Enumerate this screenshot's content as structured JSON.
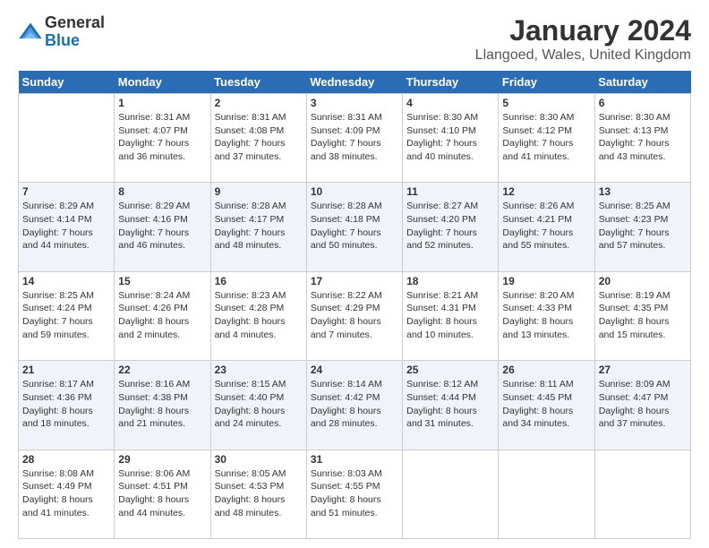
{
  "logo": {
    "general": "General",
    "blue": "Blue"
  },
  "title": "January 2024",
  "location": "Llangoed, Wales, United Kingdom",
  "weekdays": [
    "Sunday",
    "Monday",
    "Tuesday",
    "Wednesday",
    "Thursday",
    "Friday",
    "Saturday"
  ],
  "weeks": [
    [
      {
        "day": "",
        "sunrise": "",
        "sunset": "",
        "daylight": ""
      },
      {
        "day": "1",
        "sunrise": "Sunrise: 8:31 AM",
        "sunset": "Sunset: 4:07 PM",
        "daylight": "Daylight: 7 hours and 36 minutes."
      },
      {
        "day": "2",
        "sunrise": "Sunrise: 8:31 AM",
        "sunset": "Sunset: 4:08 PM",
        "daylight": "Daylight: 7 hours and 37 minutes."
      },
      {
        "day": "3",
        "sunrise": "Sunrise: 8:31 AM",
        "sunset": "Sunset: 4:09 PM",
        "daylight": "Daylight: 7 hours and 38 minutes."
      },
      {
        "day": "4",
        "sunrise": "Sunrise: 8:30 AM",
        "sunset": "Sunset: 4:10 PM",
        "daylight": "Daylight: 7 hours and 40 minutes."
      },
      {
        "day": "5",
        "sunrise": "Sunrise: 8:30 AM",
        "sunset": "Sunset: 4:12 PM",
        "daylight": "Daylight: 7 hours and 41 minutes."
      },
      {
        "day": "6",
        "sunrise": "Sunrise: 8:30 AM",
        "sunset": "Sunset: 4:13 PM",
        "daylight": "Daylight: 7 hours and 43 minutes."
      }
    ],
    [
      {
        "day": "7",
        "sunrise": "Sunrise: 8:29 AM",
        "sunset": "Sunset: 4:14 PM",
        "daylight": "Daylight: 7 hours and 44 minutes."
      },
      {
        "day": "8",
        "sunrise": "Sunrise: 8:29 AM",
        "sunset": "Sunset: 4:16 PM",
        "daylight": "Daylight: 7 hours and 46 minutes."
      },
      {
        "day": "9",
        "sunrise": "Sunrise: 8:28 AM",
        "sunset": "Sunset: 4:17 PM",
        "daylight": "Daylight: 7 hours and 48 minutes."
      },
      {
        "day": "10",
        "sunrise": "Sunrise: 8:28 AM",
        "sunset": "Sunset: 4:18 PM",
        "daylight": "Daylight: 7 hours and 50 minutes."
      },
      {
        "day": "11",
        "sunrise": "Sunrise: 8:27 AM",
        "sunset": "Sunset: 4:20 PM",
        "daylight": "Daylight: 7 hours and 52 minutes."
      },
      {
        "day": "12",
        "sunrise": "Sunrise: 8:26 AM",
        "sunset": "Sunset: 4:21 PM",
        "daylight": "Daylight: 7 hours and 55 minutes."
      },
      {
        "day": "13",
        "sunrise": "Sunrise: 8:25 AM",
        "sunset": "Sunset: 4:23 PM",
        "daylight": "Daylight: 7 hours and 57 minutes."
      }
    ],
    [
      {
        "day": "14",
        "sunrise": "Sunrise: 8:25 AM",
        "sunset": "Sunset: 4:24 PM",
        "daylight": "Daylight: 7 hours and 59 minutes."
      },
      {
        "day": "15",
        "sunrise": "Sunrise: 8:24 AM",
        "sunset": "Sunset: 4:26 PM",
        "daylight": "Daylight: 8 hours and 2 minutes."
      },
      {
        "day": "16",
        "sunrise": "Sunrise: 8:23 AM",
        "sunset": "Sunset: 4:28 PM",
        "daylight": "Daylight: 8 hours and 4 minutes."
      },
      {
        "day": "17",
        "sunrise": "Sunrise: 8:22 AM",
        "sunset": "Sunset: 4:29 PM",
        "daylight": "Daylight: 8 hours and 7 minutes."
      },
      {
        "day": "18",
        "sunrise": "Sunrise: 8:21 AM",
        "sunset": "Sunset: 4:31 PM",
        "daylight": "Daylight: 8 hours and 10 minutes."
      },
      {
        "day": "19",
        "sunrise": "Sunrise: 8:20 AM",
        "sunset": "Sunset: 4:33 PM",
        "daylight": "Daylight: 8 hours and 13 minutes."
      },
      {
        "day": "20",
        "sunrise": "Sunrise: 8:19 AM",
        "sunset": "Sunset: 4:35 PM",
        "daylight": "Daylight: 8 hours and 15 minutes."
      }
    ],
    [
      {
        "day": "21",
        "sunrise": "Sunrise: 8:17 AM",
        "sunset": "Sunset: 4:36 PM",
        "daylight": "Daylight: 8 hours and 18 minutes."
      },
      {
        "day": "22",
        "sunrise": "Sunrise: 8:16 AM",
        "sunset": "Sunset: 4:38 PM",
        "daylight": "Daylight: 8 hours and 21 minutes."
      },
      {
        "day": "23",
        "sunrise": "Sunrise: 8:15 AM",
        "sunset": "Sunset: 4:40 PM",
        "daylight": "Daylight: 8 hours and 24 minutes."
      },
      {
        "day": "24",
        "sunrise": "Sunrise: 8:14 AM",
        "sunset": "Sunset: 4:42 PM",
        "daylight": "Daylight: 8 hours and 28 minutes."
      },
      {
        "day": "25",
        "sunrise": "Sunrise: 8:12 AM",
        "sunset": "Sunset: 4:44 PM",
        "daylight": "Daylight: 8 hours and 31 minutes."
      },
      {
        "day": "26",
        "sunrise": "Sunrise: 8:11 AM",
        "sunset": "Sunset: 4:45 PM",
        "daylight": "Daylight: 8 hours and 34 minutes."
      },
      {
        "day": "27",
        "sunrise": "Sunrise: 8:09 AM",
        "sunset": "Sunset: 4:47 PM",
        "daylight": "Daylight: 8 hours and 37 minutes."
      }
    ],
    [
      {
        "day": "28",
        "sunrise": "Sunrise: 8:08 AM",
        "sunset": "Sunset: 4:49 PM",
        "daylight": "Daylight: 8 hours and 41 minutes."
      },
      {
        "day": "29",
        "sunrise": "Sunrise: 8:06 AM",
        "sunset": "Sunset: 4:51 PM",
        "daylight": "Daylight: 8 hours and 44 minutes."
      },
      {
        "day": "30",
        "sunrise": "Sunrise: 8:05 AM",
        "sunset": "Sunset: 4:53 PM",
        "daylight": "Daylight: 8 hours and 48 minutes."
      },
      {
        "day": "31",
        "sunrise": "Sunrise: 8:03 AM",
        "sunset": "Sunset: 4:55 PM",
        "daylight": "Daylight: 8 hours and 51 minutes."
      },
      {
        "day": "",
        "sunrise": "",
        "sunset": "",
        "daylight": ""
      },
      {
        "day": "",
        "sunrise": "",
        "sunset": "",
        "daylight": ""
      },
      {
        "day": "",
        "sunrise": "",
        "sunset": "",
        "daylight": ""
      }
    ]
  ]
}
